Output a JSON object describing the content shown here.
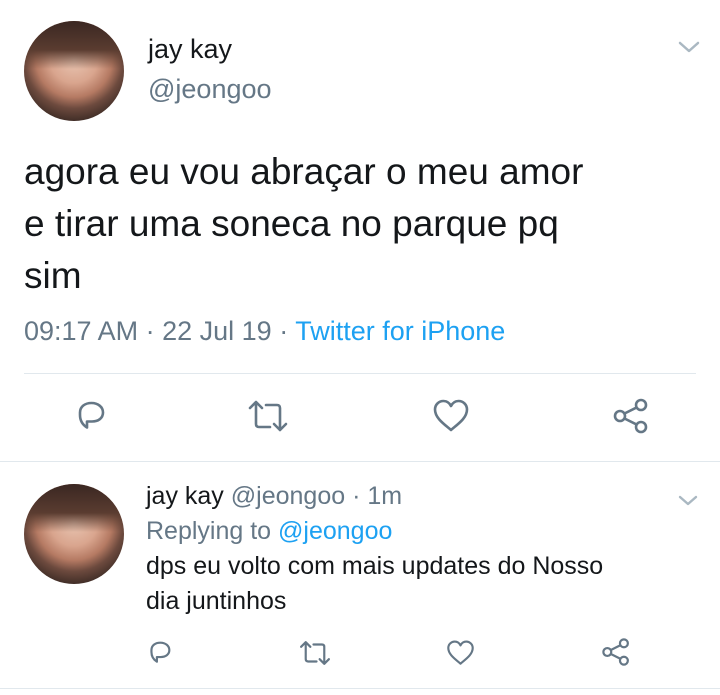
{
  "main_tweet": {
    "author_name": "jay kay",
    "author_handle": "@jeongoo",
    "text_lines": [
      "agora eu vou abraçar o meu amor",
      "e tirar uma soneca no parque pq",
      "sim"
    ],
    "time": "09:17 AM",
    "sep1": "·",
    "date": "22 Jul 19",
    "sep2": "·",
    "source": "Twitter for iPhone",
    "actions": [
      "reply-icon",
      "retweet-icon",
      "like-icon",
      "share-icon"
    ]
  },
  "reply_tweet": {
    "author_name": "jay kay",
    "author_handle": "@jeongoo",
    "sep": "·",
    "age": "1m",
    "replying_prefix": "Replying to",
    "replying_handle": "@jeongoo",
    "text_lines": [
      "dps eu volto com mais updates do Nosso",
      "dia juntinhos"
    ],
    "actions": [
      "reply-icon",
      "retweet-icon",
      "like-icon",
      "share-icon"
    ]
  },
  "colors": {
    "text": "#14171a",
    "muted": "#657786",
    "link": "#1da1f2",
    "divider": "#e1e8ed"
  }
}
